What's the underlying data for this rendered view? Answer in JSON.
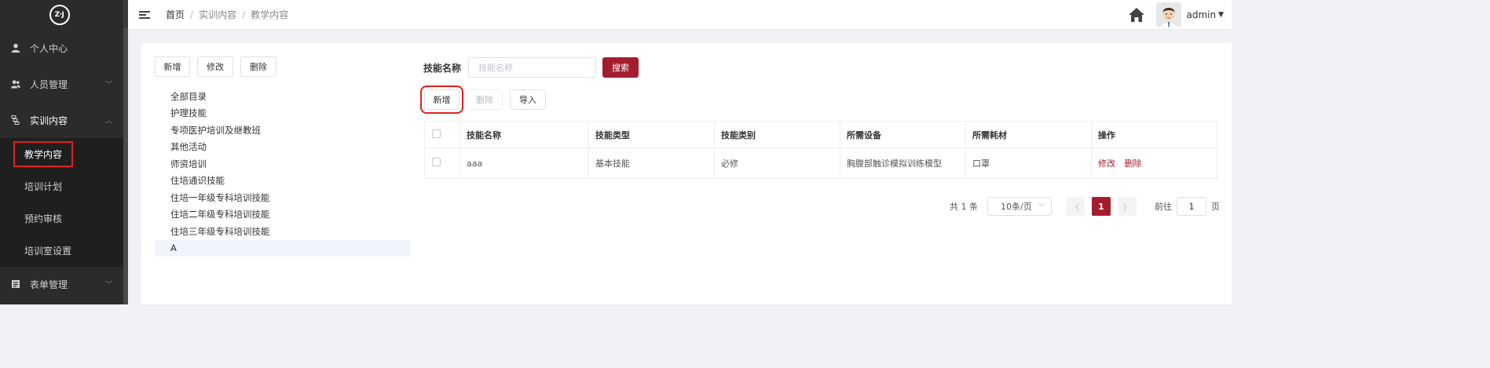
{
  "logo": {
    "text": "Z·J"
  },
  "sidebar": {
    "items": [
      {
        "label": "个人中心",
        "icon": "user-icon"
      },
      {
        "label": "人员管理",
        "icon": "users-icon"
      },
      {
        "label": "实训内容",
        "icon": "book-icon"
      }
    ],
    "submenu": [
      "教学内容",
      "培训计划",
      "预约审核",
      "培训室设置"
    ],
    "last_item": {
      "label": "表单管理",
      "icon": "form-icon"
    }
  },
  "header": {
    "breadcrumb": [
      "首页",
      "实训内容",
      "教学内容"
    ],
    "user": "admin"
  },
  "left_toolbar": {
    "add": "新增",
    "edit": "修改",
    "delete": "删除"
  },
  "tree": [
    "全部目录",
    "护理技能",
    "专项医护培训及继教班",
    "其他活动",
    "师资培训",
    "住培通识技能",
    "住培一年级专科培训技能",
    "住培二年级专科培训技能",
    "住培三年级专科培训技能",
    "A"
  ],
  "search": {
    "label": "技能名称",
    "placeholder": "技能名称",
    "button": "搜索"
  },
  "table_toolbar": {
    "add": "新增",
    "delete": "删除",
    "import": "导入"
  },
  "table": {
    "headers": [
      "技能名称",
      "技能类型",
      "技能类别",
      "所需设备",
      "所需耗材",
      "操作"
    ],
    "rows": [
      {
        "name": "aaa",
        "type": "基本技能",
        "category": "必修",
        "equipment": "胸腹部触诊模拟训练模型",
        "consumable": "口罩",
        "edit": "修改",
        "delete": "删除"
      }
    ]
  },
  "pagination": {
    "total": "共 1 条",
    "page_size": "10条/页",
    "current": "1",
    "goto_label": "前往",
    "goto_value": "1",
    "goto_suffix": "页"
  },
  "colors": {
    "accent": "#a31d2e",
    "sidebar_bg": "#2b2b2b",
    "highlight": "#e02020"
  }
}
